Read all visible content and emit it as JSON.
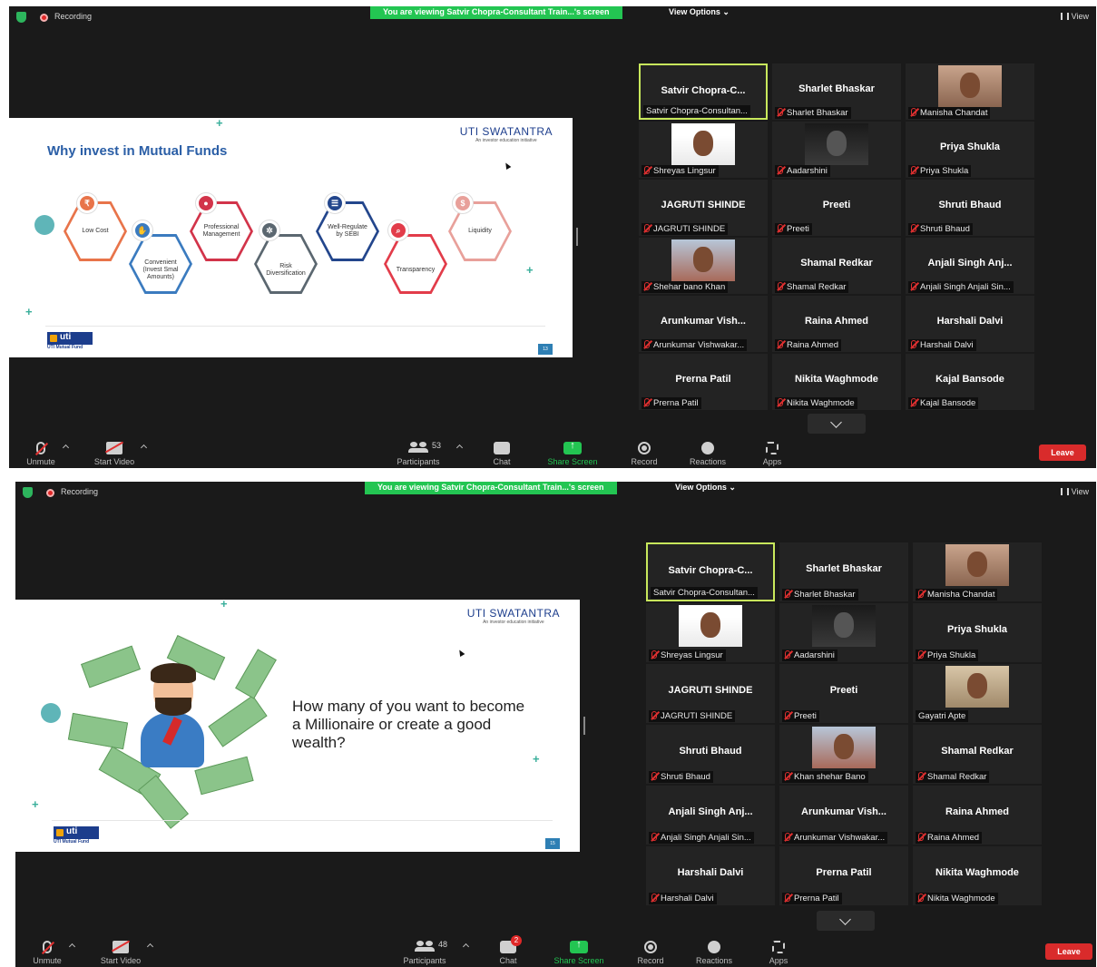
{
  "common": {
    "recording_label": "Recording",
    "viewing_banner": "You are viewing Satvir Chopra-Consultant Train...'s screen",
    "view_options": "View Options ⌄",
    "view_label": "View",
    "brand_title": "UTI SWATANTRA",
    "brand_sub": "An investor education initiative",
    "uti_logo": "uti",
    "uti_logo_sub": "UTI Mutual Fund",
    "leave_label": "Leave",
    "toolbar": {
      "unmute": "Unmute",
      "start_video": "Start Video",
      "participants": "Participants",
      "chat": "Chat",
      "share_screen": "Share Screen",
      "record": "Record",
      "reactions": "Reactions",
      "apps": "Apps"
    }
  },
  "shot1": {
    "participants_count": "53",
    "slide": {
      "title": "Why invest in Mutual Funds",
      "page_number": "13",
      "hexagons": [
        {
          "label": "Low Cost"
        },
        {
          "label": "Convenient (Invest Smal Amounts)"
        },
        {
          "label": "Professional Management"
        },
        {
          "label": "Risk Diversification"
        },
        {
          "label": "Well-Regulate by SEBI"
        },
        {
          "label": "Transparency"
        },
        {
          "label": "Liquidity"
        }
      ]
    },
    "tiles": [
      {
        "name": "Satvir Chopra-C...",
        "label": "Satvir Chopra-Consultan..."
      },
      {
        "name": "Sharlet Bhaskar",
        "label": "Sharlet Bhaskar"
      },
      {
        "name": "",
        "label": "Manisha Chandat"
      },
      {
        "name": "",
        "label": "Shreyas Lingsur"
      },
      {
        "name": "",
        "label": "Aadarshini"
      },
      {
        "name": "Priya Shukla",
        "label": "Priya Shukla"
      },
      {
        "name": "JAGRUTI SHINDE",
        "label": "JAGRUTI SHINDE"
      },
      {
        "name": "Preeti",
        "label": "Preeti"
      },
      {
        "name": "Shruti Bhaud",
        "label": "Shruti Bhaud"
      },
      {
        "name": "",
        "label": "Shehar bano Khan"
      },
      {
        "name": "Shamal Redkar",
        "label": "Shamal Redkar"
      },
      {
        "name": "Anjali Singh Anj...",
        "label": "Anjali Singh Anjali Sin..."
      },
      {
        "name": "Arunkumar Vish...",
        "label": "Arunkumar Vishwakar..."
      },
      {
        "name": "Raina Ahmed",
        "label": "Raina Ahmed"
      },
      {
        "name": "Harshali Dalvi",
        "label": "Harshali Dalvi"
      },
      {
        "name": "Prerna Patil",
        "label": "Prerna Patil"
      },
      {
        "name": "Nikita Waghmode",
        "label": "Nikita Waghmode"
      },
      {
        "name": "Kajal Bansode",
        "label": "Kajal Bansode"
      }
    ]
  },
  "shot2": {
    "participants_count": "48",
    "chat_badge": "2",
    "slide": {
      "headline": "How many of you want to become a Millionaire or create a good wealth?",
      "page_number": "15"
    },
    "tiles": [
      {
        "name": "Satvir Chopra-C...",
        "label": "Satvir Chopra-Consultan..."
      },
      {
        "name": "Sharlet Bhaskar",
        "label": "Sharlet Bhaskar"
      },
      {
        "name": "",
        "label": "Manisha Chandat"
      },
      {
        "name": "",
        "label": "Shreyas Lingsur"
      },
      {
        "name": "",
        "label": "Aadarshini"
      },
      {
        "name": "Priya Shukla",
        "label": "Priya Shukla"
      },
      {
        "name": "JAGRUTI SHINDE",
        "label": "JAGRUTI SHINDE"
      },
      {
        "name": "Preeti",
        "label": "Preeti"
      },
      {
        "name": "",
        "label": "Gayatri Apte"
      },
      {
        "name": "Shruti Bhaud",
        "label": "Shruti Bhaud"
      },
      {
        "name": "",
        "label": "Khan shehar Bano"
      },
      {
        "name": "Shamal Redkar",
        "label": "Shamal Redkar"
      },
      {
        "name": "Anjali Singh Anj...",
        "label": "Anjali Singh Anjali Sin..."
      },
      {
        "name": "Arunkumar Vish...",
        "label": "Arunkumar Vishwakar..."
      },
      {
        "name": "Raina Ahmed",
        "label": "Raina Ahmed"
      },
      {
        "name": "Harshali Dalvi",
        "label": "Harshali Dalvi"
      },
      {
        "name": "Prerna Patil",
        "label": "Prerna Patil"
      },
      {
        "name": "Nikita Waghmode",
        "label": "Nikita Waghmode"
      }
    ]
  }
}
